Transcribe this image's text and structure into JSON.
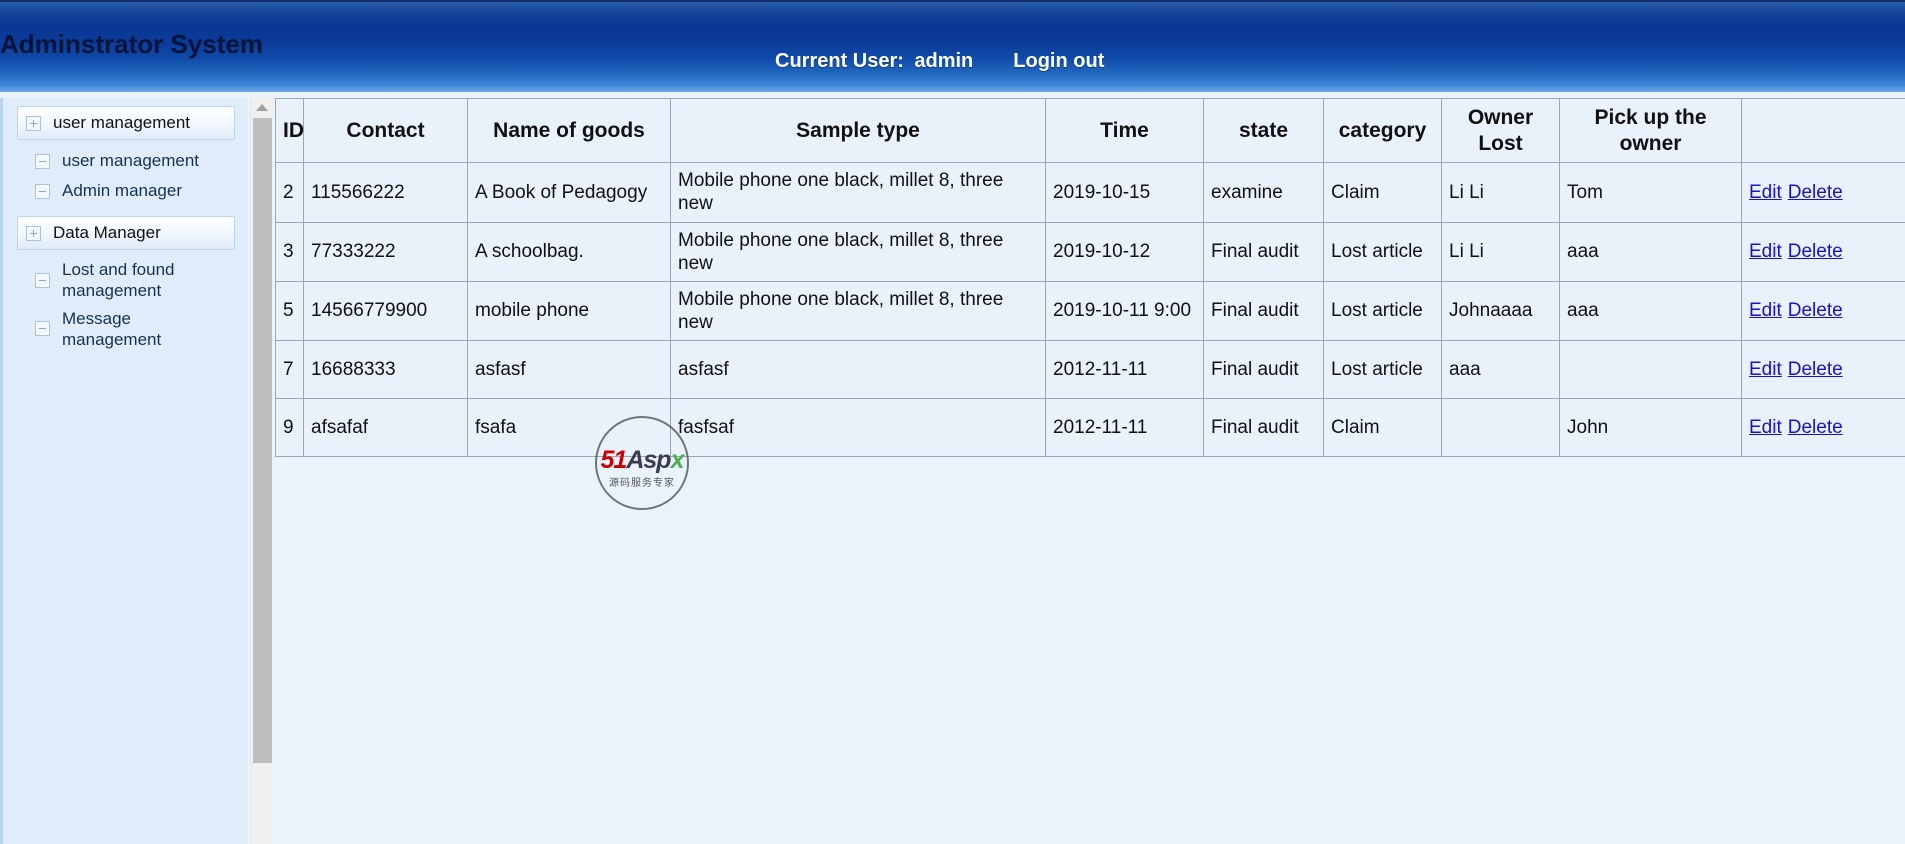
{
  "header": {
    "title": "Adminstrator System",
    "current_user_label": "Current User:",
    "current_user_name": "admin",
    "logout_label": "Login out",
    "accent_color": "#0b3894"
  },
  "sidebar": {
    "nodes": [
      {
        "label": "user management",
        "level": "root",
        "icon": "plus-icon",
        "selected": true
      },
      {
        "label": "user management",
        "level": "child",
        "icon": "minus-icon",
        "selected": false
      },
      {
        "label": "Admin manager",
        "level": "child",
        "icon": "minus-icon",
        "selected": false
      },
      {
        "label": "Data Manager",
        "level": "root",
        "icon": "plus-icon",
        "selected": true
      },
      {
        "label": "Lost and found management",
        "level": "child",
        "icon": "minus-icon",
        "selected": false
      },
      {
        "label": "Message management",
        "level": "child",
        "icon": "minus-icon",
        "selected": false
      }
    ]
  },
  "table": {
    "columns": [
      "ID",
      "Contact",
      "Name of goods",
      "Sample type",
      "Time",
      "state",
      "category",
      "Owner Lost",
      "Pick up the owner",
      ""
    ],
    "actions": {
      "edit_label": "Edit",
      "delete_label": "Delete"
    },
    "rows": [
      {
        "id": "2",
        "contact": "115566222",
        "goods": "A Book of Pedagogy",
        "sample": "Mobile phone one black, millet 8, three new",
        "time": "2019-10-15",
        "state": "examine",
        "category": "Claim",
        "owner_lost": "Li Li",
        "pick_up": "Tom"
      },
      {
        "id": "3",
        "contact": "77333222",
        "goods": "A schoolbag.",
        "sample": "Mobile phone one black, millet 8, three new",
        "time": "2019-10-12",
        "state": "Final audit",
        "category": "Lost article",
        "owner_lost": "Li Li",
        "pick_up": "aaa"
      },
      {
        "id": "5",
        "contact": "14566779900",
        "goods": "mobile phone",
        "sample": "Mobile phone one black, millet 8, three new",
        "time": "2019-10-11 9:00",
        "state": "Final audit",
        "category": "Lost article",
        "owner_lost": "Johnaaaa",
        "pick_up": "aaa"
      },
      {
        "id": "7",
        "contact": "16688333",
        "goods": "asfasf",
        "sample": "asfasf",
        "time": "2012-11-11",
        "state": "Final audit",
        "category": "Lost article",
        "owner_lost": "aaa",
        "pick_up": ""
      },
      {
        "id": "9",
        "contact": "afsafaf",
        "goods": "fsafa",
        "sample": "fasfsaf",
        "time": "2012-11-11",
        "state": "Final audit",
        "category": "Claim",
        "owner_lost": "",
        "pick_up": "John"
      }
    ]
  },
  "watermark": {
    "part1": "51",
    "part2": "Asp",
    "part3": "x",
    "subtitle": "源码服务专家"
  }
}
